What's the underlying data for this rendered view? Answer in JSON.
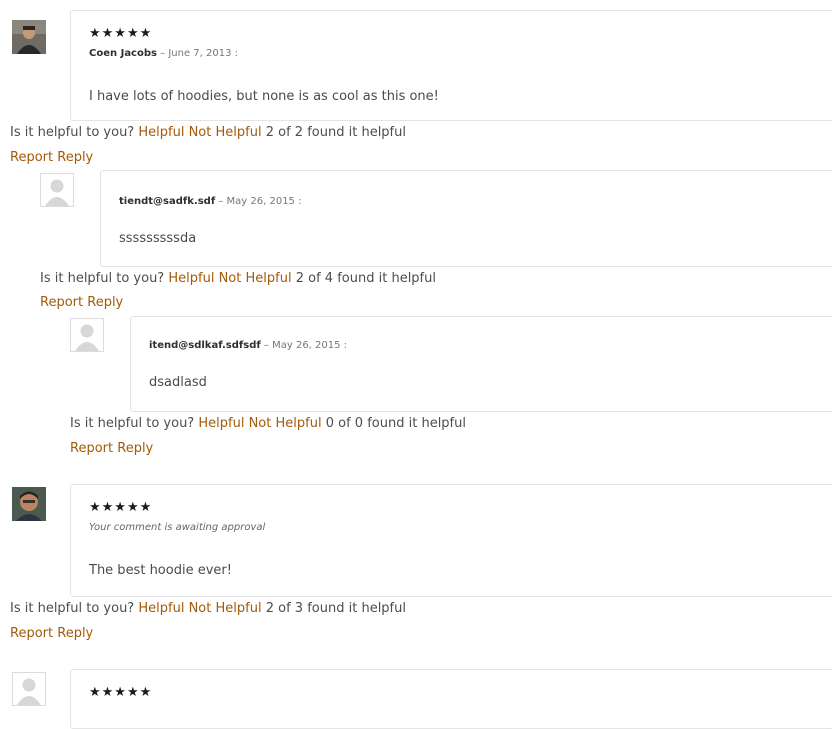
{
  "helpful_prompt": "Is it helpful to you?",
  "helpful_label": "Helpful",
  "not_helpful_label": "Not Helpful",
  "found_suffix": "found it helpful",
  "of_word": "of",
  "report_label": "Report",
  "reply_label": "Reply",
  "comments": [
    {
      "stars": "★★★★★",
      "rating": 5,
      "author": "Coen Jacobs",
      "date": "– June 7, 2013 :",
      "text": "I have lots of hoodies, but none is as cool as this one!",
      "helpful_count": "2",
      "total_count": "2"
    },
    {
      "author": "tiendt@sadfk.sdf",
      "date": "– May 26, 2015 :",
      "text": "sssssssssda",
      "helpful_count": "2",
      "total_count": "4"
    },
    {
      "author": "itend@sdlkaf.sdfsdf",
      "date": "– May 26, 2015 :",
      "text": "dsadlasd",
      "helpful_count": "0",
      "total_count": "0"
    },
    {
      "stars": "★★★★★",
      "rating": 5,
      "pending": "Your comment is awaiting approval",
      "text": "The best hoodie ever!",
      "helpful_count": "2",
      "total_count": "3"
    },
    {
      "stars": "★★★★★",
      "rating": 5
    }
  ],
  "colors": {
    "link": "#a35a0a",
    "text": "#4d4d4d",
    "border": "#e4e4e4"
  }
}
